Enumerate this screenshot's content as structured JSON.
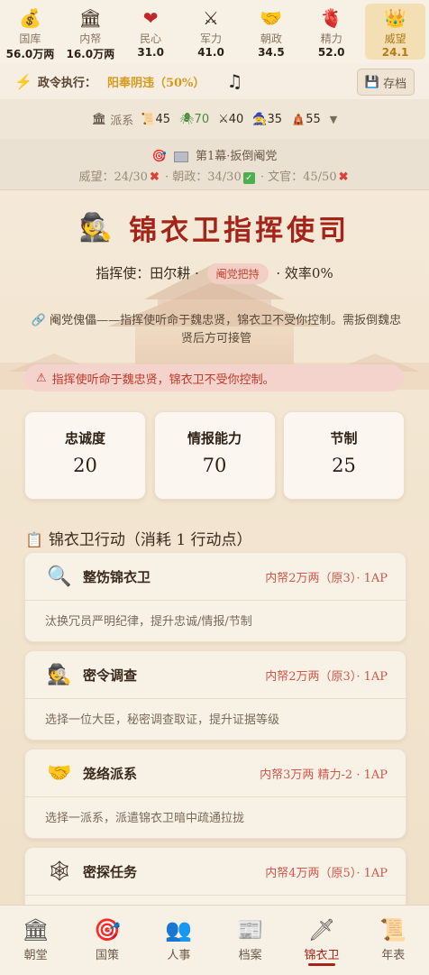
{
  "stats": [
    {
      "icon": "money-bag-icon",
      "glyph": "💰",
      "label": "国库",
      "value": "56.0万两"
    },
    {
      "icon": "treasury-building-icon",
      "glyph": "🏛",
      "label": "内帑",
      "value": "16.0万两"
    },
    {
      "icon": "heart-icon",
      "glyph": "❤",
      "label": "民心",
      "value": "31.0"
    },
    {
      "icon": "crossed-swords-icon",
      "glyph": "⚔",
      "label": "军力",
      "value": "41.0"
    },
    {
      "icon": "handshake-icon",
      "glyph": "🤝",
      "label": "朝政",
      "value": "34.5"
    },
    {
      "icon": "anatomical-heart-icon",
      "glyph": "🫀",
      "label": "精力",
      "value": "52.0"
    },
    {
      "icon": "crown-icon",
      "glyph": "👑",
      "label": "威望",
      "value": "24.1"
    }
  ],
  "policy": {
    "label": "政令执行：",
    "value": "阳奉阴违（50%）",
    "save_label": "存档"
  },
  "factions": {
    "label": "派系",
    "items": [
      {
        "icon": "scroll-icon",
        "glyph": "📜",
        "value": "45"
      },
      {
        "icon": "spider-icon",
        "glyph": "🕷",
        "value": "70"
      },
      {
        "icon": "swords-icon",
        "glyph": "⚔",
        "value": "40"
      },
      {
        "icon": "monk-icon",
        "glyph": "🧙",
        "value": "35"
      },
      {
        "icon": "temple-icon",
        "glyph": "🛕",
        "value": "55"
      }
    ]
  },
  "act": {
    "title": "第1幕·扳倒阉党",
    "req1": "威望：24/30",
    "req2": "· 朝政：34/30",
    "req3": "· 文官：45/50"
  },
  "header": {
    "title": "锦衣卫指挥使司",
    "commander_prefix": "指挥使：田尔耕 ·",
    "tag": "阉党把持",
    "efficiency": "· 效率0%"
  },
  "description": "🔗 阉党傀儡——指挥使听命于魏忠贤，锦衣卫不受你控制。需扳倒魏忠贤后方可接管",
  "warning": "指挥使听命于魏忠贤，锦衣卫不受你控制。",
  "cards": [
    {
      "label": "忠诚度",
      "value": "20"
    },
    {
      "label": "情报能力",
      "value": "70"
    },
    {
      "label": "节制",
      "value": "25"
    }
  ],
  "section_title": "锦衣卫行动（消耗 1 行动点）",
  "actions": [
    {
      "icon": "magnifier-icon",
      "glyph": "🔍",
      "title": "整饬锦衣卫",
      "cost": "内帑2万两（原3）· 1AP",
      "desc": "汰换冗员严明纪律，提升忠诚/情报/节制"
    },
    {
      "icon": "detective-icon",
      "glyph": "🕵",
      "title": "密令调查",
      "cost": "内帑2万两（原3）· 1AP",
      "desc": "选择一位大臣，秘密调查取证，提升证据等级"
    },
    {
      "icon": "handshake-icon",
      "glyph": "🤝",
      "title": "笼络派系",
      "cost": "内帑3万两 精力-2 · 1AP",
      "desc": "选择一派系，派遣锦衣卫暗中疏通拉拢"
    },
    {
      "icon": "spider-web-icon",
      "glyph": "🕸",
      "title": "密探任务",
      "cost": "内帑4万两（原5）· 1AP",
      "desc": ""
    }
  ],
  "nav": [
    {
      "icon": "court-building-icon",
      "glyph": "🏛",
      "label": "朝堂"
    },
    {
      "icon": "target-icon",
      "glyph": "🎯",
      "label": "国策"
    },
    {
      "icon": "people-icon",
      "glyph": "👥",
      "label": "人事"
    },
    {
      "icon": "archive-icon",
      "glyph": "📰",
      "label": "档案"
    },
    {
      "icon": "dagger-icon",
      "glyph": "🗡",
      "label": "锦衣卫"
    },
    {
      "icon": "scroll-icon",
      "glyph": "📜",
      "label": "年表"
    }
  ]
}
